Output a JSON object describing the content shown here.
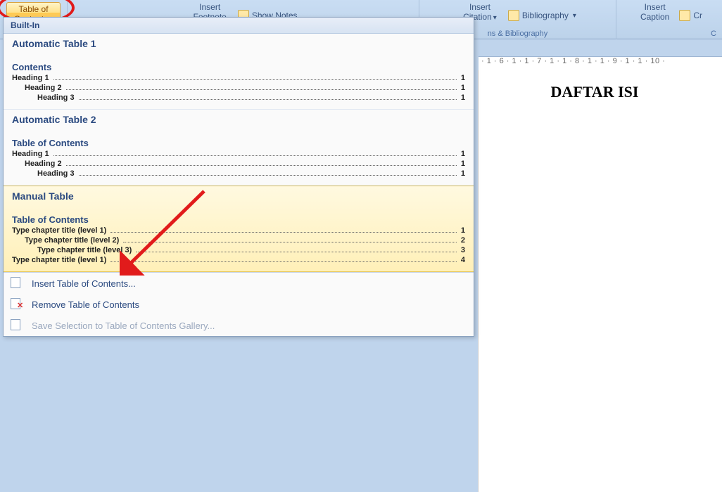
{
  "ribbon": {
    "toc": {
      "line1": "Table of",
      "line2": "Contents"
    },
    "insert_footnote": {
      "line1": "Insert",
      "line2": "Footnote"
    },
    "show_notes": "Show Notes",
    "insert_citation": {
      "line1": "Insert",
      "line2": "Citation"
    },
    "bibliography": "Bibliography",
    "citations_group": "ns & Bibliography",
    "insert_caption": {
      "line1": "Insert",
      "line2": "Caption"
    },
    "create": "Cr",
    "captions_group": "C"
  },
  "ruler": "· 1 · 6 · 1 · 1 · 7 · 1 · 1 · 8 · 1 · 1 · 9 · 1 · 1 · 10 ·",
  "document": {
    "title": "DAFTAR ISI"
  },
  "gallery": {
    "section_label": "Built-In",
    "items": [
      {
        "title": "Automatic Table 1",
        "subtitle": "Contents",
        "lines": [
          {
            "label": "Heading 1",
            "page": "1",
            "indent": 0
          },
          {
            "label": "Heading 2",
            "page": "1",
            "indent": 1
          },
          {
            "label": "Heading 3",
            "page": "1",
            "indent": 2
          }
        ]
      },
      {
        "title": "Automatic Table 2",
        "subtitle": "Table of Contents",
        "lines": [
          {
            "label": "Heading 1",
            "page": "1",
            "indent": 0
          },
          {
            "label": "Heading 2",
            "page": "1",
            "indent": 1
          },
          {
            "label": "Heading 3",
            "page": "1",
            "indent": 2
          }
        ]
      },
      {
        "title": "Manual Table",
        "subtitle": "Table of Contents",
        "highlighted": true,
        "lines": [
          {
            "label": "Type chapter title (level 1)",
            "page": "1",
            "indent": 0
          },
          {
            "label": "Type chapter title (level 2)",
            "page": "2",
            "indent": 1
          },
          {
            "label": "Type chapter title (level 3)",
            "page": "3",
            "indent": 2
          },
          {
            "label": "Type chapter title (level 1)",
            "page": "4",
            "indent": 0
          }
        ]
      }
    ],
    "footer": {
      "insert": "Insert Table of Contents...",
      "remove": "Remove Table of Contents",
      "save": "Save Selection to Table of Contents Gallery..."
    }
  }
}
